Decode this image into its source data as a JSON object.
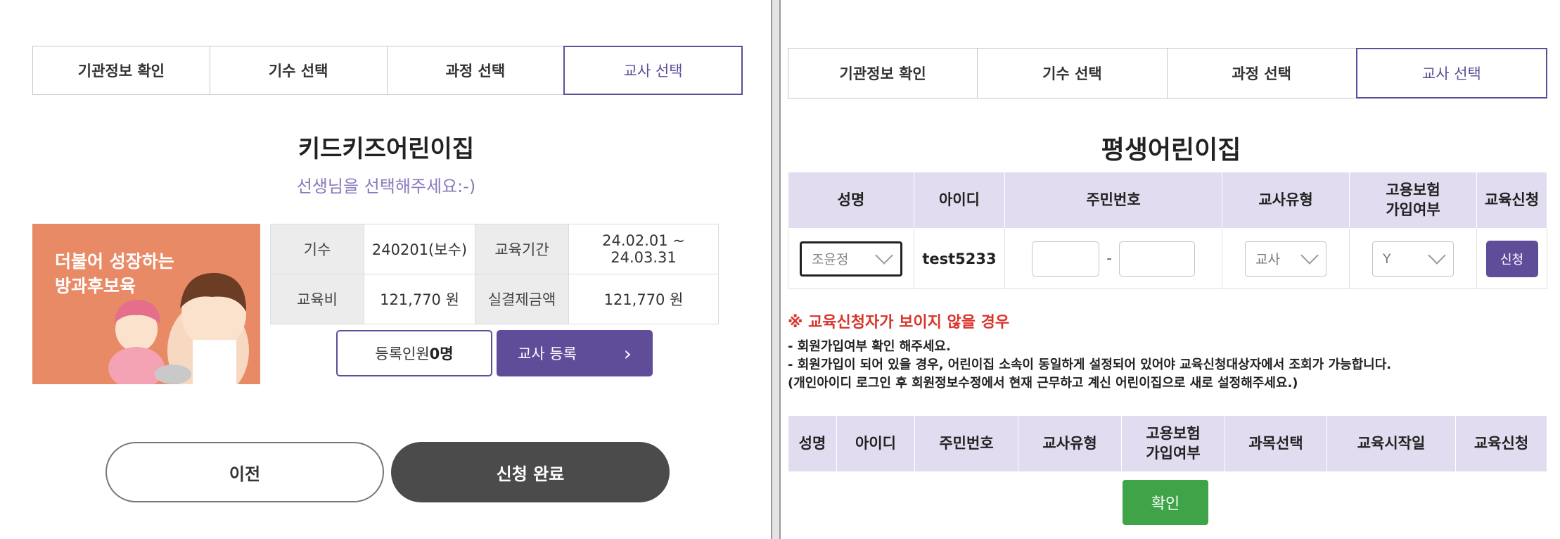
{
  "tabs": [
    "기관정보 확인",
    "기수 선택",
    "과정 선택",
    "교사 선택"
  ],
  "left": {
    "title": "키드키즈어린이집",
    "subtitle": "선생님을 선택해주세요:-)",
    "banner_text": [
      "더불어 성장하는",
      "방과후보육"
    ],
    "info": {
      "term_label": "기수",
      "term_value": "240201(보수)",
      "period_label": "교육기간",
      "period_value": "24.02.01 ~ 24.03.31",
      "fee_label": "교육비",
      "fee_value": "121,770 원",
      "actual_label": "실결제금액",
      "actual_value": "121,770 원"
    },
    "registered_prefix": "등록인원 ",
    "registered_count": "0명",
    "register_teacher": "교사 등록",
    "register_arrow": "›",
    "prev": "이전",
    "complete": "신청 완료"
  },
  "right": {
    "title": "평생어린이집",
    "columns": [
      "성명",
      "아이디",
      "주민번호",
      "교사유형",
      "고용보험\n가입여부",
      "교육신청"
    ],
    "row": {
      "name": "조윤정",
      "id": "test5233",
      "dash": "-",
      "type": "교사",
      "insurance": "Y",
      "apply": "신청"
    },
    "notice_title": "※ 교육신청자가 보이지 않을 경우",
    "notice_lines": [
      "- 회원가입여부 확인 해주세요.",
      "- 회원가입이 되어 있을 경우, 어린이집 소속이 동일하게 설정되어 있어야 교육신청대상자에서 조회가 가능합니다.",
      "(개인아이디 로그인 후 회원정보수정에서 현재 근무하고 계신 어린이집으로 새로 설정해주세요.)"
    ],
    "columns2": [
      "성명",
      "아이디",
      "주민번호",
      "교사유형",
      "고용보험\n가입여부",
      "과목선택",
      "교육시작일",
      "교육신청"
    ],
    "confirm": "확인"
  },
  "colors": {
    "accent": "#5f4d9a",
    "banner": "#e98a66",
    "confirm": "#3fa448",
    "notice": "#d9342b",
    "header_bg": "#e1dcef"
  }
}
